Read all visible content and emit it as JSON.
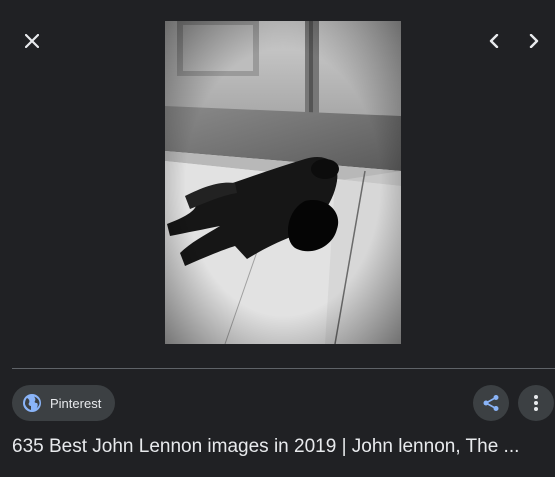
{
  "viewer": {
    "close_label": "Close",
    "prev_label": "Previous",
    "next_label": "Next"
  },
  "image": {
    "alt": "Black and white photograph of a figure in a dark coat lying face down on a pavement beside a wall"
  },
  "source": {
    "name": "Pinterest",
    "icon": "globe-icon"
  },
  "actions": {
    "share_icon": "share-icon",
    "more_icon": "more-vert-icon"
  },
  "result": {
    "title": "635 Best John Lennon images in 2019 | John lennon, The ..."
  },
  "colors": {
    "background": "#202124",
    "chip": "#3c4043",
    "text": "#e8eaed",
    "accent": "#8ab4f8"
  }
}
